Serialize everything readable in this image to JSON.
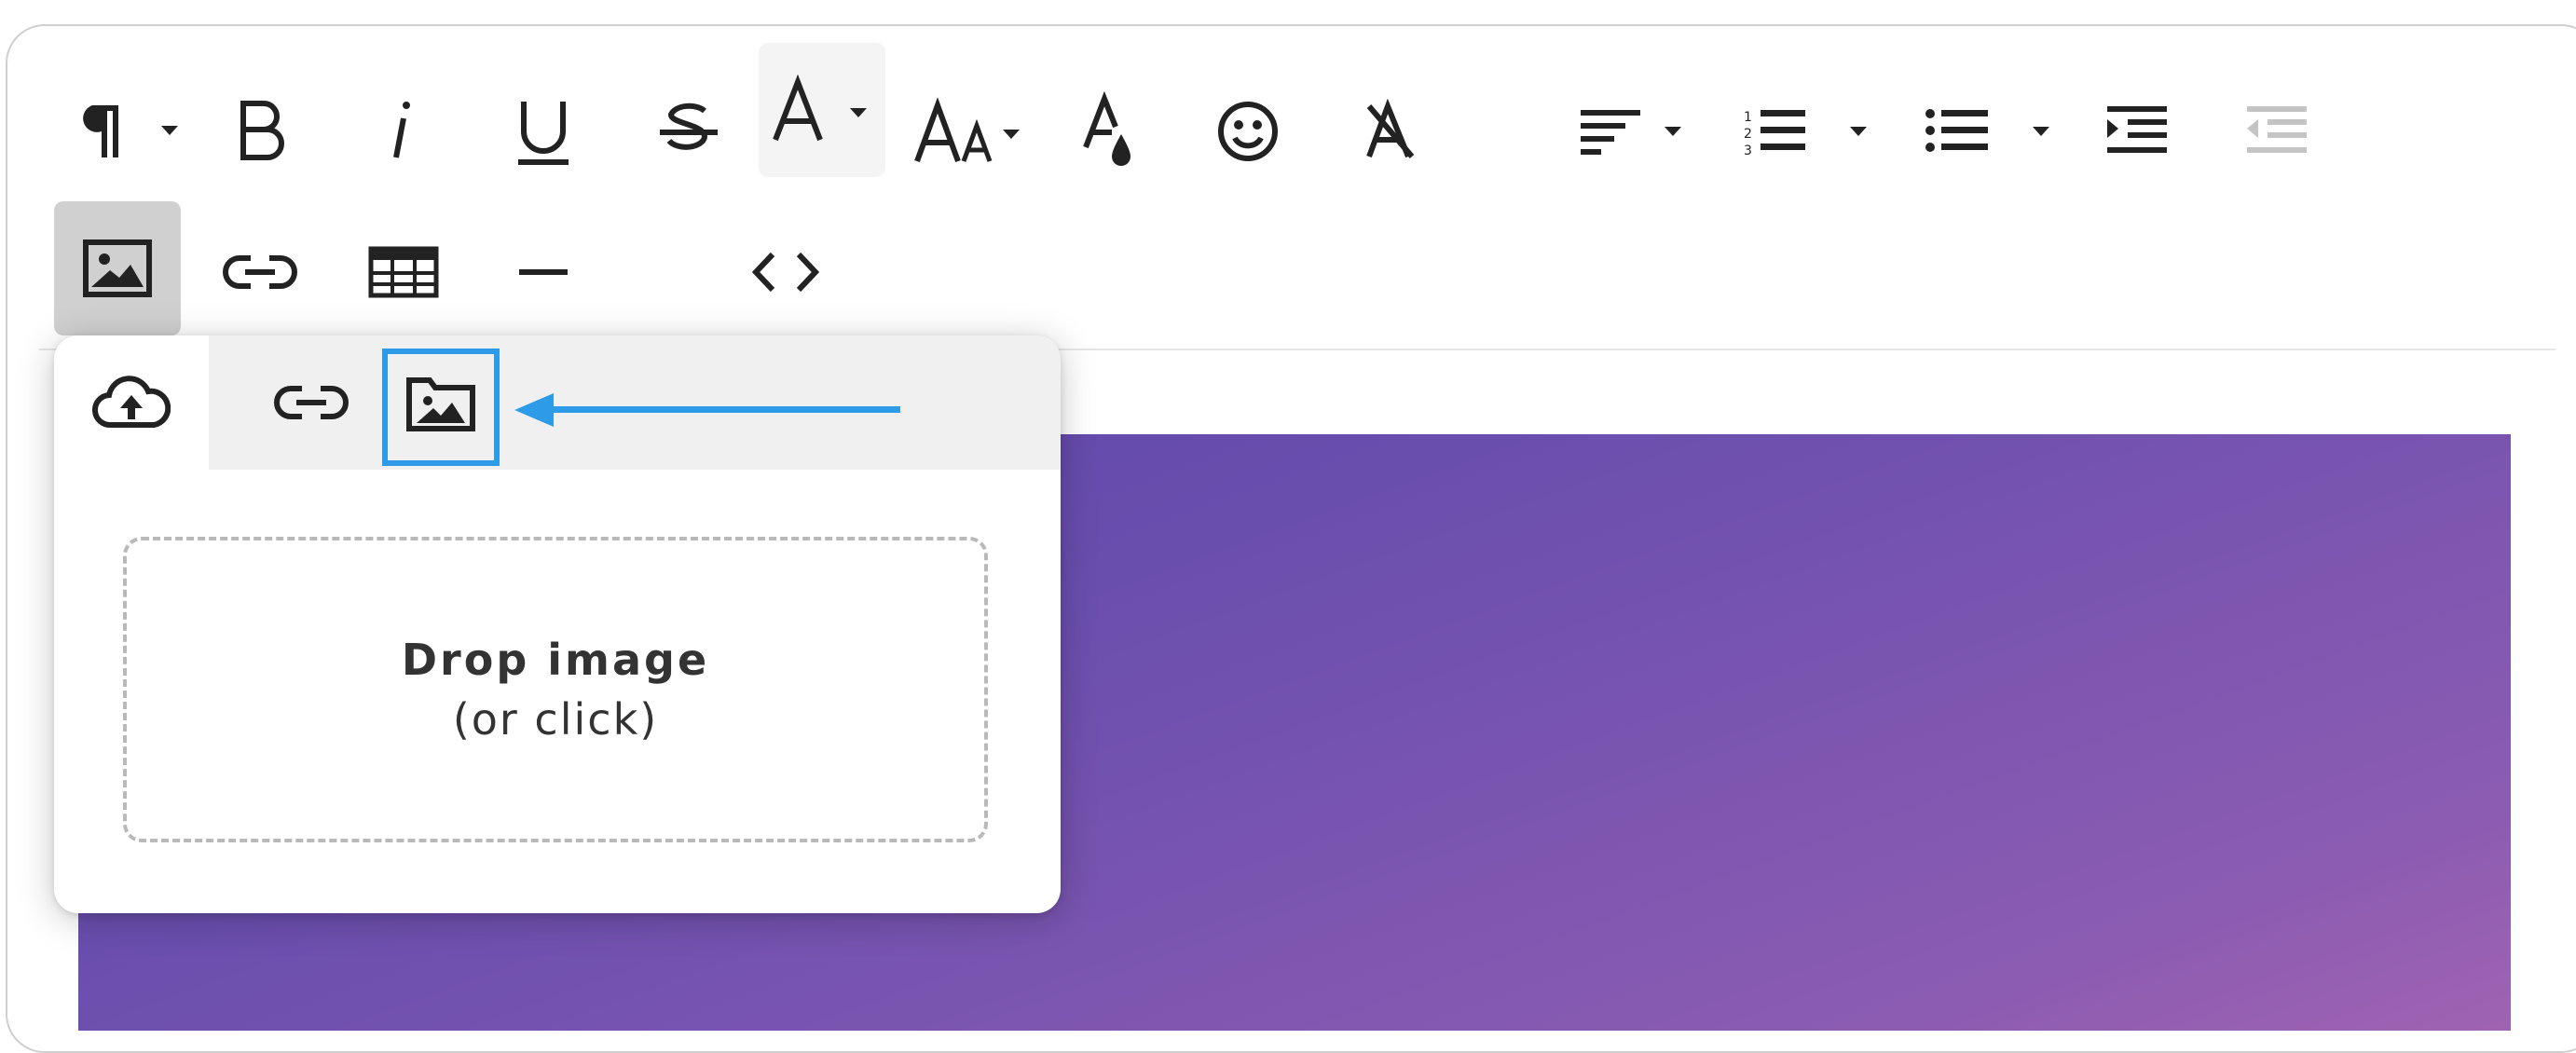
{
  "toolbar": {
    "row1": [
      {
        "name": "paragraph-format",
        "icon": "pilcrow-icon",
        "dropdown": true
      },
      {
        "name": "bold",
        "icon": "bold-icon"
      },
      {
        "name": "italic",
        "icon": "italic-icon"
      },
      {
        "name": "underline",
        "icon": "underline-icon"
      },
      {
        "name": "strikethrough",
        "icon": "strikethrough-icon"
      },
      {
        "name": "font-family",
        "icon": "font-icon",
        "dropdown": true,
        "active": true
      },
      {
        "name": "font-size",
        "icon": "font-size-icon",
        "dropdown": true
      },
      {
        "name": "text-color",
        "icon": "text-color-icon"
      },
      {
        "name": "emoticons",
        "icon": "smiley-icon"
      },
      {
        "name": "clear-formatting",
        "icon": "clear-format-icon"
      },
      {
        "name": "align",
        "icon": "align-left-icon",
        "dropdown": true
      },
      {
        "name": "ordered-list",
        "icon": "ordered-list-icon",
        "dropdown": true
      },
      {
        "name": "unordered-list",
        "icon": "bullet-list-icon",
        "dropdown": true
      },
      {
        "name": "indent",
        "icon": "indent-icon"
      },
      {
        "name": "outdent",
        "icon": "outdent-icon",
        "disabled": true
      }
    ],
    "row2": [
      {
        "name": "insert-image",
        "icon": "image-icon",
        "active": true
      },
      {
        "name": "insert-link",
        "icon": "link-icon"
      },
      {
        "name": "insert-table",
        "icon": "table-icon"
      },
      {
        "name": "horizontal-line",
        "icon": "hr-icon"
      },
      {
        "name": "code-view",
        "icon": "code-icon"
      }
    ]
  },
  "image_popup": {
    "tabs": [
      {
        "name": "upload",
        "icon": "cloud-upload-icon",
        "active": true
      },
      {
        "name": "by-url",
        "icon": "link-icon"
      },
      {
        "name": "image-manager",
        "icon": "image-folder-icon",
        "highlighted": true
      }
    ],
    "dropzone": {
      "title": "Drop image",
      "subtitle": "(or click)"
    }
  },
  "colors": {
    "accent_highlight": "#2d9be8",
    "icon": "#222222",
    "hero_gradient_start": "#5a45a8",
    "hero_gradient_end": "#a063b2"
  }
}
